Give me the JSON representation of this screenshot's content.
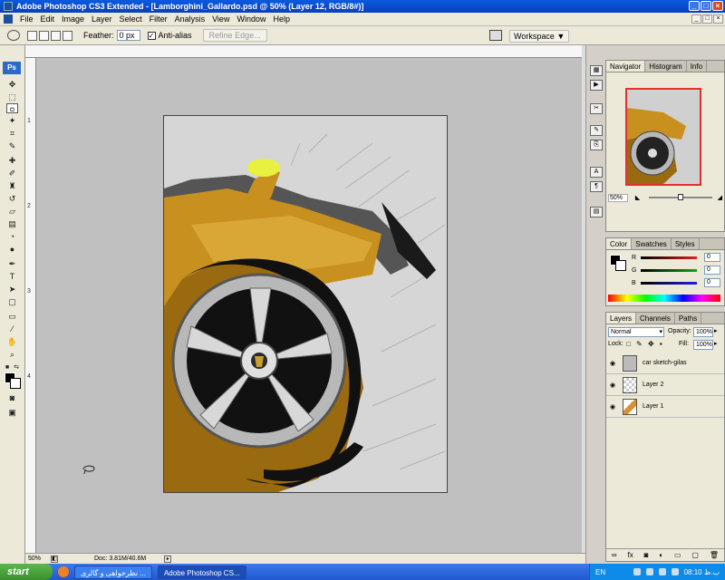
{
  "window": {
    "title": "Adobe Photoshop CS3 Extended - [Lamborghini_Gallardo.psd @ 50% (Layer 12, RGB/8#)]"
  },
  "menu": [
    "File",
    "Edit",
    "Image",
    "Layer",
    "Select",
    "Filter",
    "Analysis",
    "View",
    "Window",
    "Help"
  ],
  "options": {
    "feather_label": "Feather:",
    "feather_value": "0 px",
    "antialias_label": "Anti-alias",
    "refine_label": "Refine Edge...",
    "workspace_label": "Workspace ▼"
  },
  "tools": {
    "ps_logo": "Ps"
  },
  "ruler_v_labels": [
    "1",
    "2",
    "3",
    "4"
  ],
  "status": {
    "zoom": "50%",
    "doc": "Doc: 3.81M/40.6M"
  },
  "navigator": {
    "tabs": [
      "Navigator",
      "Histogram",
      "Info"
    ],
    "zoom": "50%"
  },
  "color": {
    "tabs": [
      "Color",
      "Swatches",
      "Styles"
    ],
    "channels": [
      {
        "name": "R",
        "value": "0",
        "bar": "#e02020"
      },
      {
        "name": "G",
        "value": "0",
        "bar": "#20a020"
      },
      {
        "name": "B",
        "value": "0",
        "bar": "#2020e0"
      }
    ]
  },
  "layers": {
    "tabs": [
      "Layers",
      "Channels",
      "Paths"
    ],
    "blend_mode": "Normal",
    "opacity_label": "Opacity:",
    "opacity": "100%",
    "lock_label": "Lock:",
    "fill_label": "Fill:",
    "fill": "100%",
    "items": [
      {
        "name": "car sketch-gilas"
      },
      {
        "name": "Layer 2"
      },
      {
        "name": "Layer 1"
      }
    ],
    "bottom_icons": [
      "link-icon",
      "fx-icon",
      "mask-icon",
      "adjustment-icon",
      "group-icon",
      "new-layer-icon",
      "trash-icon"
    ]
  },
  "taskbar": {
    "start": "start",
    "tasks": [
      "نظرخواهی و گالری ...",
      "Adobe Photoshop CS..."
    ],
    "lang": "EN",
    "clock": "08:10 ب.ظ"
  }
}
